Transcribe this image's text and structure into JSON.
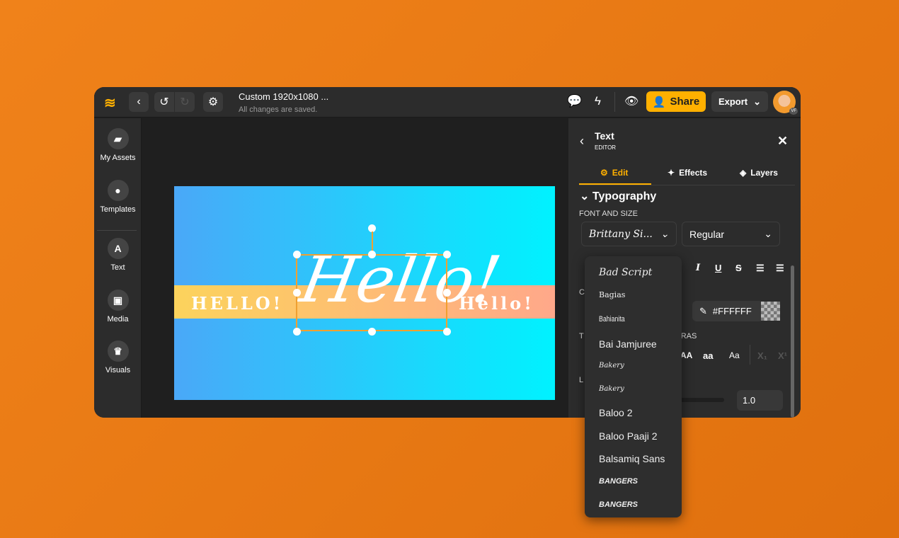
{
  "header": {
    "title": "Custom 1920x1080 ...",
    "status": "All changes are saved.",
    "share": "Share",
    "export": "Export",
    "avatar_badge": "VF"
  },
  "sidebar": {
    "items": [
      {
        "label": "My Assets",
        "icon": "folder-icon"
      },
      {
        "label": "Templates",
        "icon": "egg-icon"
      },
      {
        "label": "Text",
        "icon": "text-icon"
      },
      {
        "label": "Media",
        "icon": "image-icon"
      },
      {
        "label": "Visuals",
        "icon": "crown-icon"
      }
    ]
  },
  "canvas": {
    "left_text": "HELLO!",
    "script_text": "Hello!",
    "right_text": "Hello!"
  },
  "panel": {
    "title": "Text",
    "subtitle": "EDITOR",
    "tabs": [
      "Edit",
      "Effects",
      "Layers"
    ],
    "section": "Typography",
    "font_and_size": "FONT AND SIZE",
    "font": "Brittany Si...",
    "weight": "Regular",
    "color_hex": "#FFFFFF",
    "extras_label_partial": "TRAS",
    "case_buttons": [
      "AA",
      "aa",
      "Aa"
    ],
    "line_height": "1.0",
    "partial_labels": [
      "C",
      "T",
      "L"
    ]
  },
  "font_menu": {
    "items": [
      "Bad Script",
      "Bagias",
      "Bahianita",
      "Bai Jamjuree",
      "Bakery",
      "Bakery",
      "Baloo 2",
      "Baloo Paaji 2",
      "Balsamiq Sans",
      "Bangers",
      "Bangers"
    ]
  },
  "colors": {
    "accent": "#ffb000",
    "background": "#f0821a",
    "selection": "#f0a030"
  }
}
